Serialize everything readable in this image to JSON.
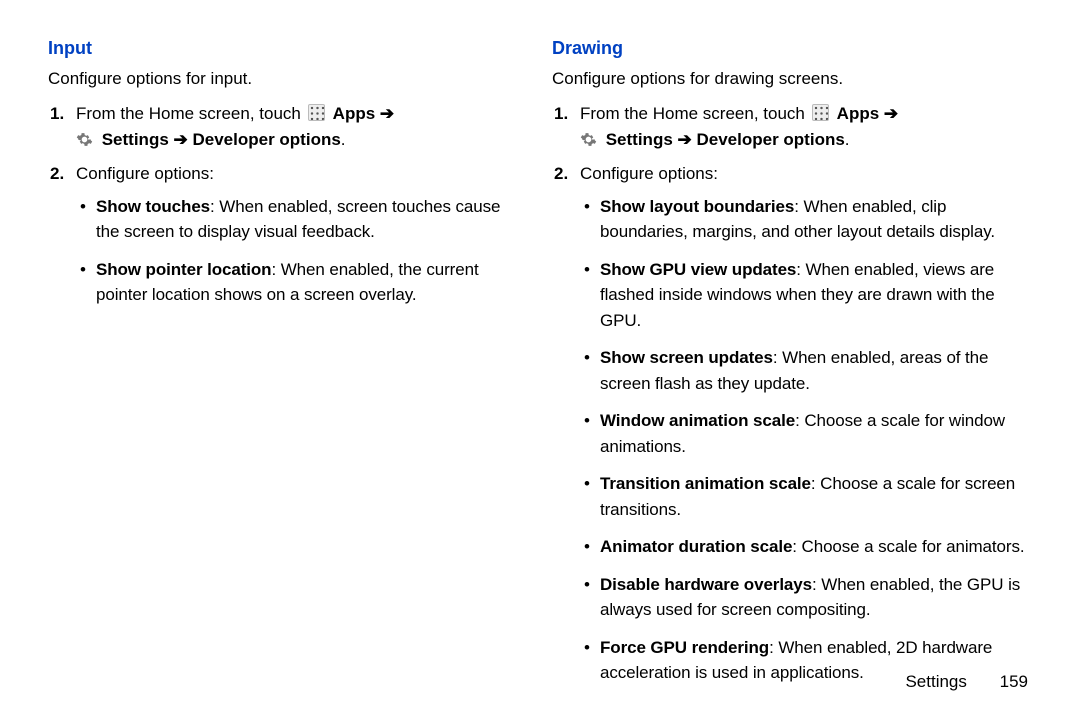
{
  "left": {
    "heading": "Input",
    "intro": "Configure options for input.",
    "steps": [
      {
        "lead": "From the Home screen, touch ",
        "apps": " Apps ",
        "arrow1": "➔",
        "settings": " Settings ",
        "arrow2": "➔",
        "devopts": " Developer options",
        "endPeriod": "."
      },
      {
        "text": "Configure options:"
      }
    ],
    "bullets": [
      {
        "title": "Show touches",
        "desc": ": When enabled, screen touches cause the screen to display visual feedback."
      },
      {
        "title": "Show pointer location",
        "desc": ": When enabled, the current pointer location shows on a screen overlay."
      }
    ]
  },
  "right": {
    "heading": "Drawing",
    "intro": "Configure options for drawing screens.",
    "steps": [
      {
        "lead": "From the Home screen, touch ",
        "apps": " Apps ",
        "arrow1": "➔",
        "settings": " Settings ",
        "arrow2": "➔",
        "devopts": " Developer options",
        "endPeriod": "."
      },
      {
        "text": "Configure options:"
      }
    ],
    "bullets": [
      {
        "title": "Show layout boundaries",
        "desc": ": When enabled, clip boundaries, margins, and other layout details display."
      },
      {
        "title": "Show GPU view updates",
        "desc": ": When enabled, views are flashed inside windows when they are drawn with the GPU."
      },
      {
        "title": "Show screen updates",
        "desc": ": When enabled, areas of the screen flash as they update."
      },
      {
        "title": "Window animation scale",
        "desc": ": Choose a scale for window animations."
      },
      {
        "title": "Transition animation scale",
        "desc": ": Choose a scale for screen transitions."
      },
      {
        "title": "Animator duration scale",
        "desc": ": Choose a scale for animators."
      },
      {
        "title": "Disable hardware overlays",
        "desc": ": When enabled, the GPU is always used for screen compositing."
      },
      {
        "title": "Force GPU rendering",
        "desc": ": When enabled, 2D hardware acceleration is used in applications."
      }
    ]
  },
  "footer": {
    "section": "Settings",
    "page": "159"
  }
}
